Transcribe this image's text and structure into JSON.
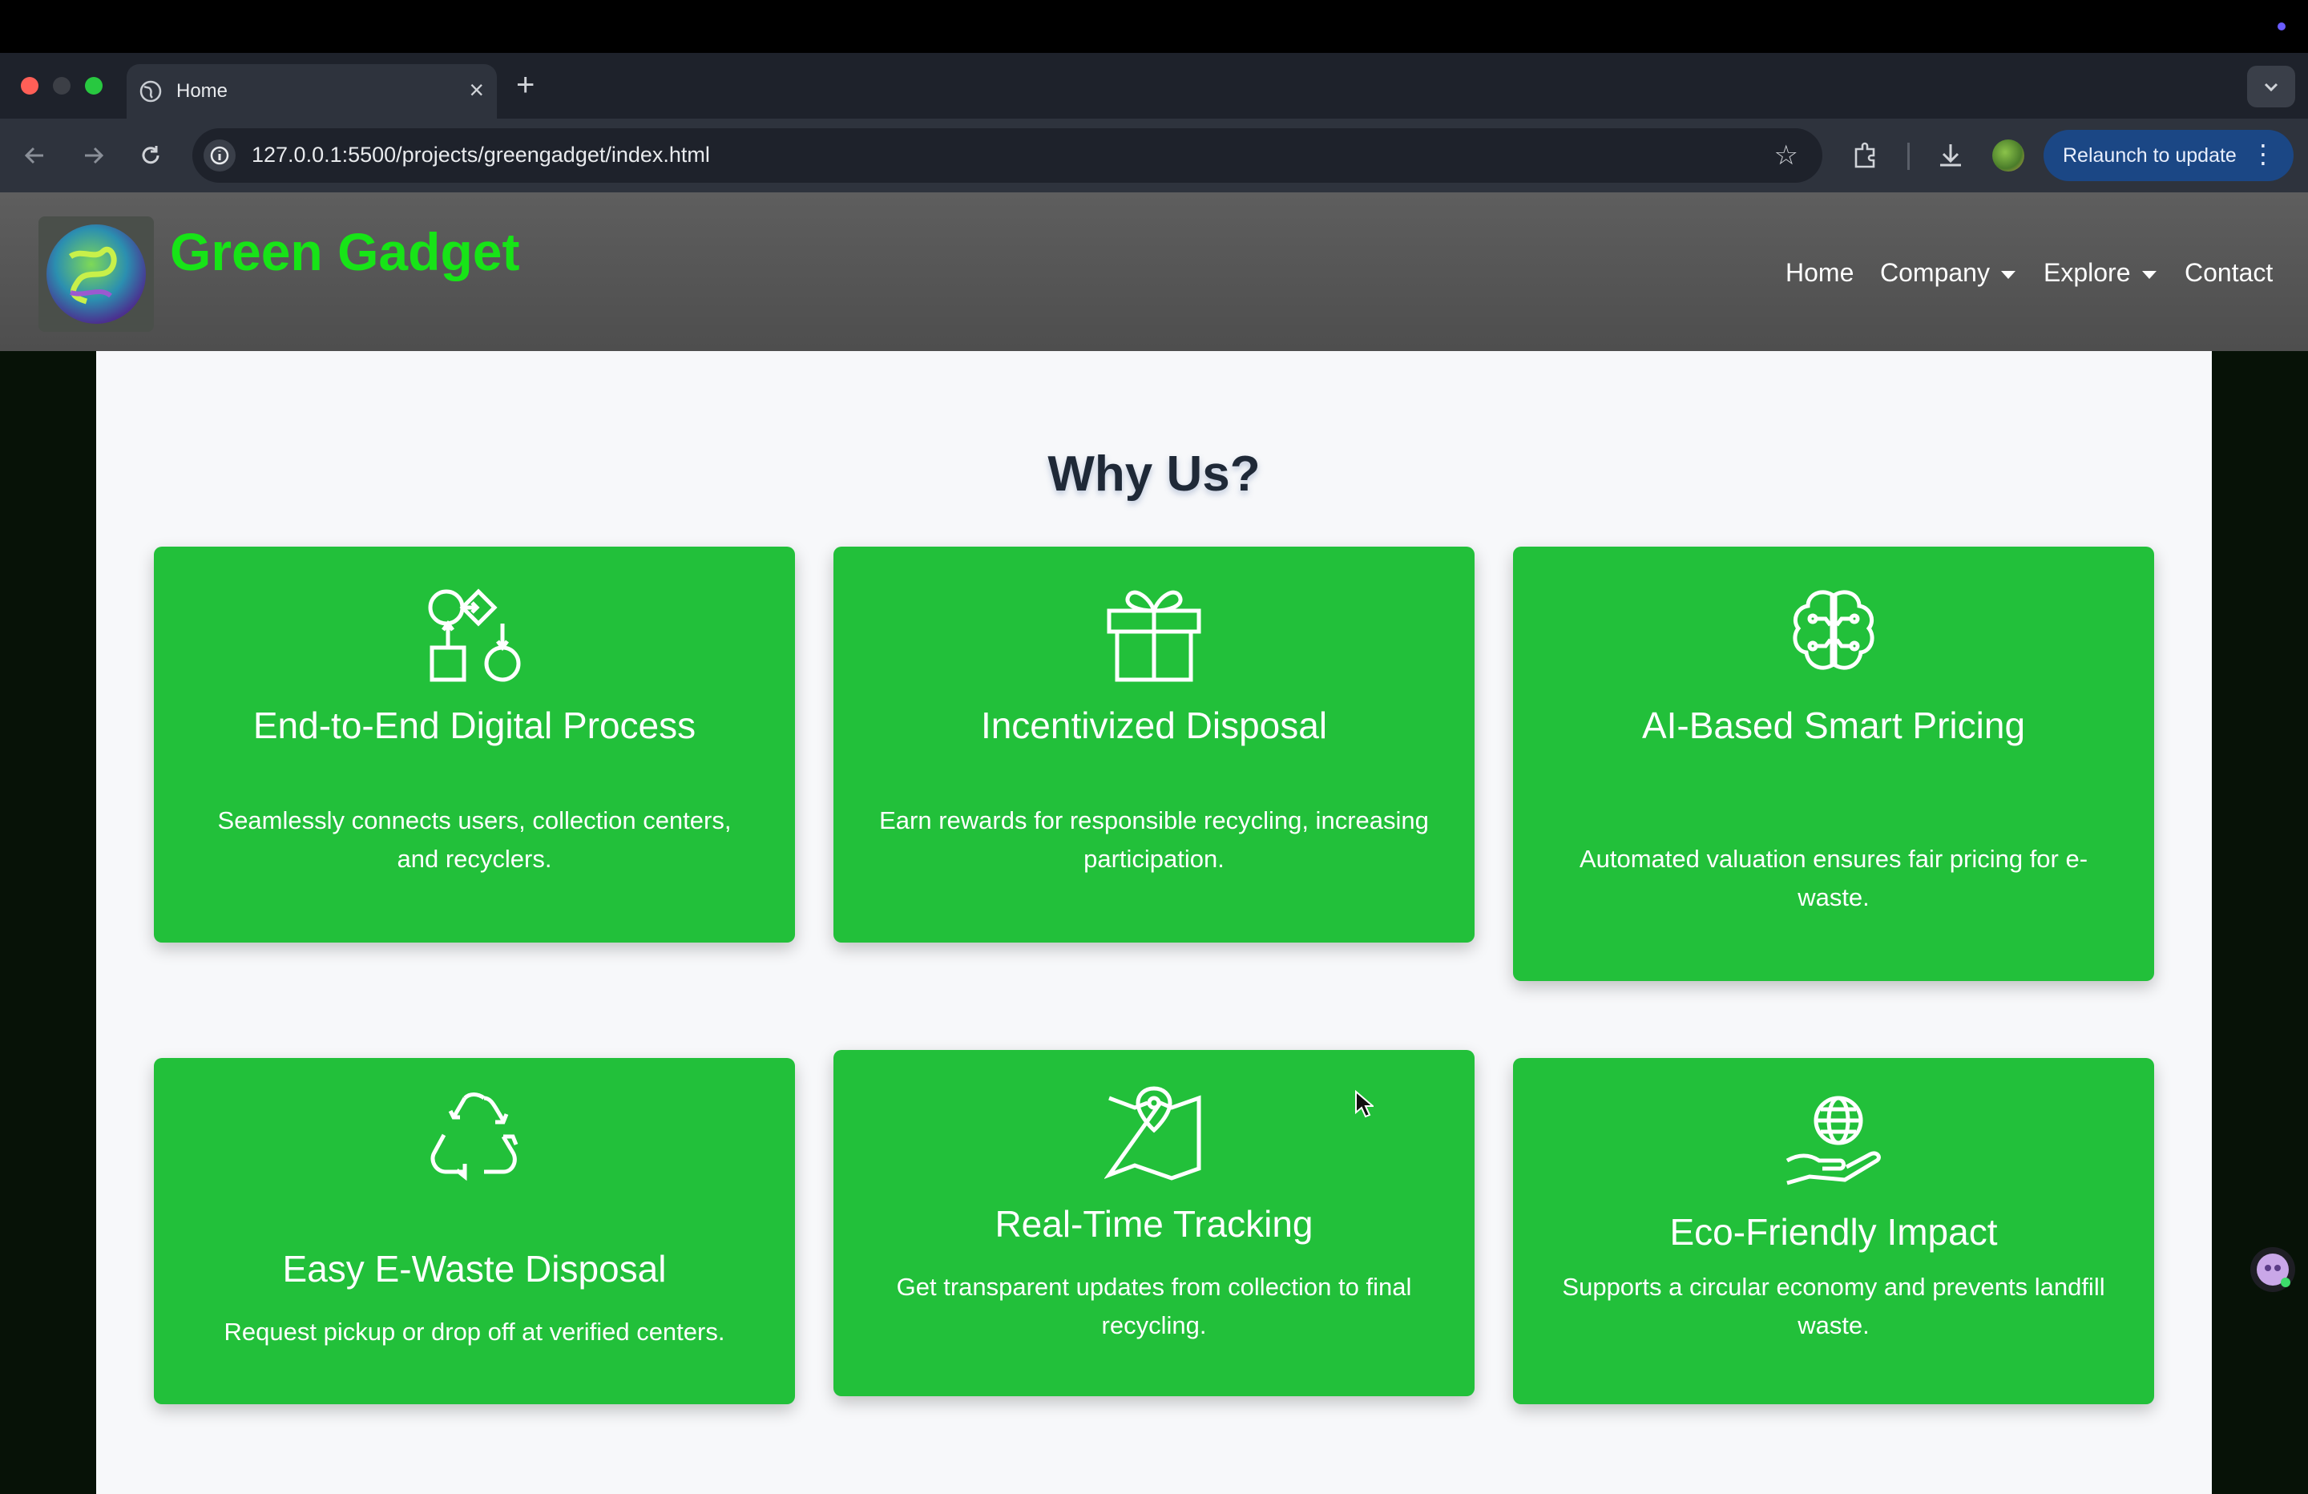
{
  "browser": {
    "tab_title": "Home",
    "tab_close": "×",
    "new_tab": "+",
    "url": "127.0.0.1:5500/projects/greengadget/index.html",
    "relaunch_label": "Relaunch to update",
    "relaunch_menu": "⋮",
    "star": "☆"
  },
  "site": {
    "brand": "Green Gadget",
    "nav": {
      "home": "Home",
      "company": "Company",
      "explore": "Explore",
      "contact": "Contact"
    }
  },
  "section": {
    "title": "Why Us?",
    "cards": [
      {
        "icon": "flowchart-icon",
        "title": "End-to-End Digital Process",
        "text": "Seamlessly connects users, collection centers, and recyclers."
      },
      {
        "icon": "gift-icon",
        "title": "Incentivized Disposal",
        "text": "Earn rewards for responsible recycling, increasing participation."
      },
      {
        "icon": "ai-brain-icon",
        "title": "AI-Based Smart Pricing",
        "text": "Automated valuation ensures fair pricing for e-waste."
      },
      {
        "icon": "recycle-icon",
        "title": "Easy E-Waste Disposal",
        "text": "Request pickup or drop off at verified centers."
      },
      {
        "icon": "map-pin-icon",
        "title": "Real-Time Tracking",
        "text": "Get transparent updates from collection to final recycling."
      },
      {
        "icon": "globe-hand-icon",
        "title": "Eco-Friendly Impact",
        "text": "Supports a circular economy and prevents landfill waste."
      }
    ]
  },
  "colors": {
    "card_green": "#22c03a",
    "brand_green": "#17e417",
    "navbar_gray": "#565656",
    "relaunch_blue": "#1b4785"
  }
}
